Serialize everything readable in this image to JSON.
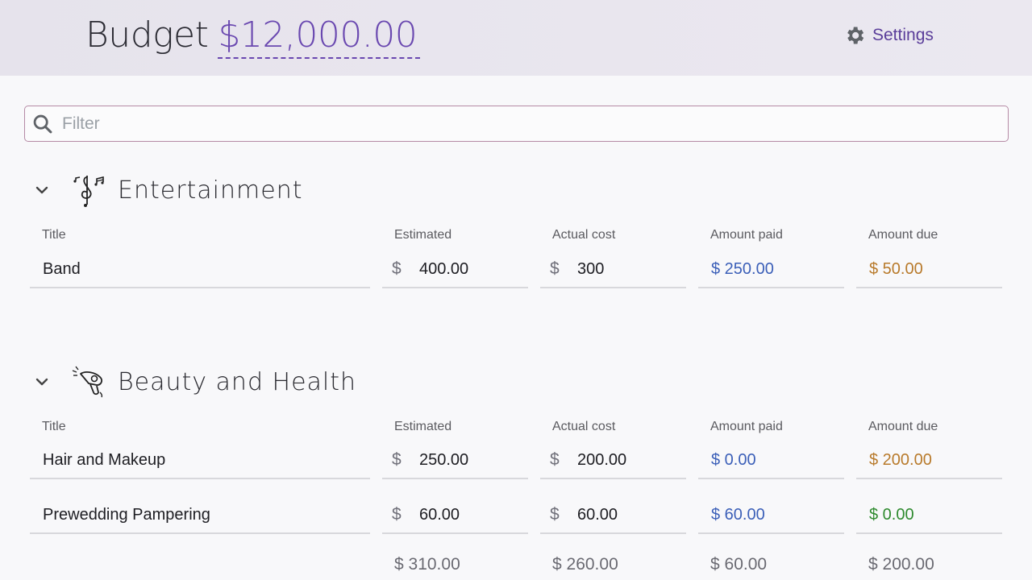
{
  "header": {
    "budget_label": "Budget",
    "budget_amount": "$12,000.00",
    "settings_label": "Settings"
  },
  "filter": {
    "placeholder": "Filter",
    "value": ""
  },
  "columns": {
    "title": "Title",
    "estimated": "Estimated",
    "actual": "Actual cost",
    "paid": "Amount paid",
    "due": "Amount due"
  },
  "currency_symbol": "$",
  "categories": [
    {
      "name": "Entertainment",
      "icon": "music-notes-icon",
      "rows": [
        {
          "title": "Band",
          "estimated": "400.00",
          "actual": "300",
          "paid": "$ 250.00",
          "due": "$ 50.00"
        }
      ]
    },
    {
      "name": "Beauty and Health",
      "icon": "hair-dryer-icon",
      "rows": [
        {
          "title": "Hair and Makeup",
          "estimated": "250.00",
          "actual": "200.00",
          "paid": "$ 0.00",
          "due": "$ 200.00"
        },
        {
          "title": "Prewedding Pampering",
          "estimated": "60.00",
          "actual": "60.00",
          "paid": "$ 60.00",
          "due": "$ 0.00"
        }
      ],
      "totals": {
        "estimated": "$ 310.00",
        "actual": "$ 260.00",
        "paid": "$ 60.00",
        "due": "$ 200.00"
      }
    }
  ],
  "colors": {
    "accent": "#6a48b0",
    "paid": "#3b5fb8",
    "due_outstanding": "#b87a2b",
    "due_settled": "#2e8a2e"
  }
}
